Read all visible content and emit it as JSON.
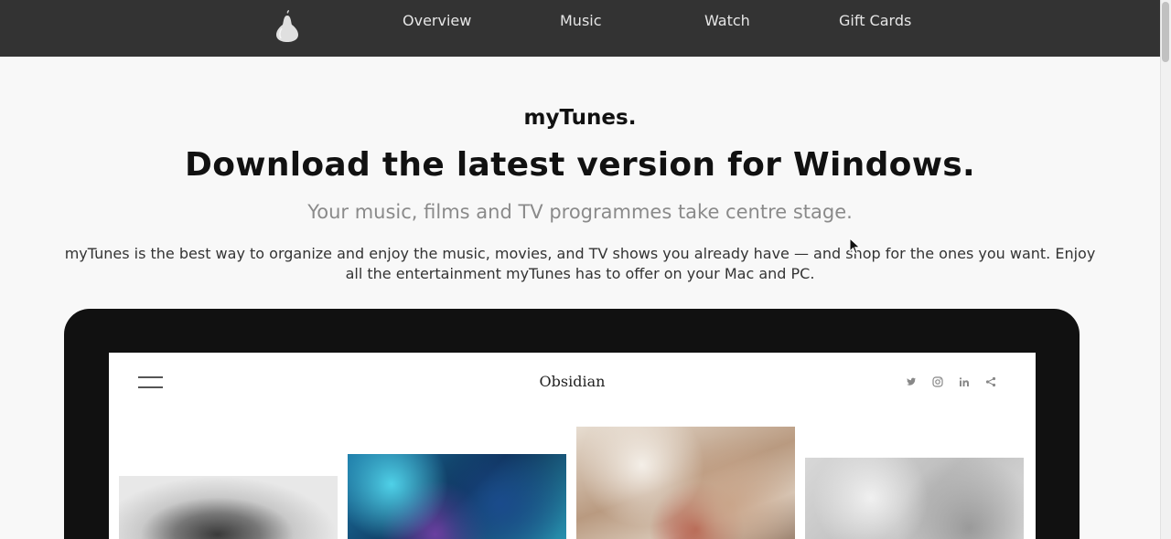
{
  "nav": {
    "logo_icon": "pear-logo-icon",
    "links": [
      "Overview",
      "Music",
      "Watch",
      "Gift Cards"
    ]
  },
  "hero": {
    "subtitle": "myTunes.",
    "title": "Download the latest version for Windows.",
    "tagline": "Your music, films and TV programmes take centre stage.",
    "description": "myTunes is the best way to organize and enjoy the music, movies, and TV shows you already have — and shop for the ones you want. Enjoy all the entertainment myTunes has to offer on your Mac and PC."
  },
  "screen": {
    "site_name": "Obsidian",
    "menu_icon": "hamburger-menu-icon",
    "social_icons": [
      "twitter-icon",
      "instagram-icon",
      "linkedin-icon",
      "share-icon"
    ]
  },
  "colors": {
    "navbar": "#333333",
    "page_bg": "#f8f8f8",
    "tagline": "#8a8a8a"
  }
}
